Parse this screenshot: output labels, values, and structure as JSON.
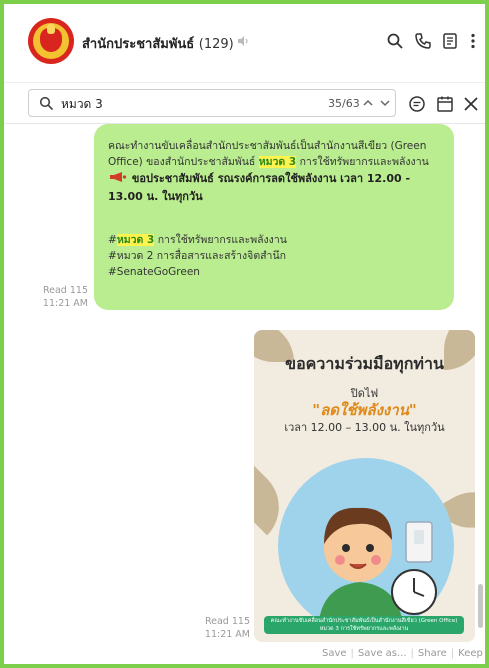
{
  "header": {
    "chat_name": "สำนักประชาสัมพันธ์",
    "member_count": "(129)",
    "icons": [
      "mute-icon",
      "search-icon",
      "phone-icon",
      "notes-icon",
      "more-icon"
    ]
  },
  "search": {
    "query": "หมวด 3",
    "result_count": "35/63",
    "icons": [
      "search-icon",
      "chevron-up-icon",
      "chevron-down-icon",
      "chat-bubble-icon",
      "calendar-icon",
      "close-icon"
    ]
  },
  "message1": {
    "line1_prefix": "คณะทำงานขับเคลื่อนสำนักประชาสัมพันธ์เป็นสำนักงานสีเขียว (Green Office) ของสำนักประชาสัมพันธ์",
    "line1_highlight": "หมวด 3",
    "line1_suffix": "การใช้ทรัพยากรและพลังงาน",
    "bold_line": "ขอประชาสัมพันธ์ รณรงค์การลดใช้พลังงาน เวลา 12.00 - 13.00 น. ในทุกวัน",
    "tag1_prefix": "#",
    "tag1_highlight": "หมวด 3",
    "tag1_suffix": "การใช้ทรัพยากรและพลังงาน",
    "tag2": "#หมวด 2 การสื่อสารและสร้างจิตสำนึก",
    "tag3": "#SenateGoGreen",
    "read": "Read 115",
    "time": "11:21 AM"
  },
  "message2": {
    "poster_title": "ขอความร่วมมือทุกท่าน",
    "poster_line2": "ปิดไฟ",
    "poster_highlight": "\"ลดใช้พลังงาน\"",
    "poster_time": "เวลา 12.00 – 13.00 น. ในทุกวัน",
    "poster_footer": "คณะทำงานขับเคลื่อนสำนักประชาสัมพันธ์เป็นสำนักงานสีเขียว (Green Office) หมวด 3 การใช้ทรัพยากรและพลังงาน",
    "read": "Read 115",
    "time": "11:21 AM",
    "actions": [
      "Save",
      "Save as...",
      "Share",
      "Keep"
    ]
  },
  "colors": {
    "frame": "#7ccf4a",
    "bubble": "#b9ed8f",
    "highlight": "#fff34d",
    "highlight_text": "#2b8a1e"
  }
}
